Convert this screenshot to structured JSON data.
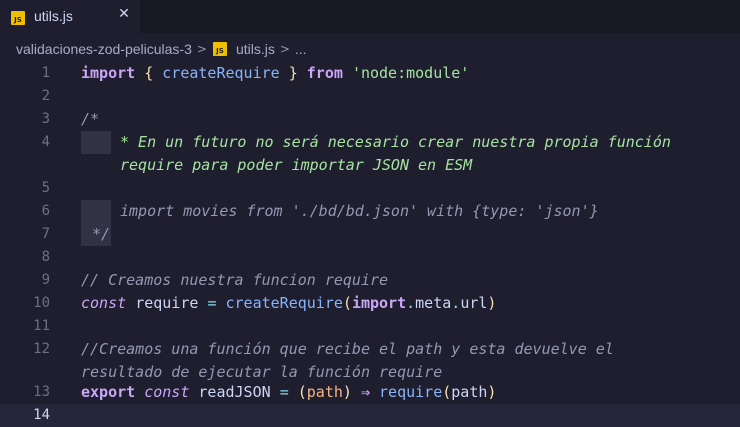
{
  "tab": {
    "icon_text": "JS",
    "label": "utils.js",
    "close_glyph": "✕"
  },
  "breadcrumb": {
    "folder": "validaciones-zod-peliculas-3",
    "file": "utils.js",
    "more": "..."
  },
  "editor": {
    "active_line": 14,
    "line_numbers": [
      "1",
      "2",
      "3",
      "4",
      "5",
      "6",
      "7",
      "8",
      "9",
      "10",
      "11",
      "12",
      "13",
      "14"
    ]
  },
  "code": {
    "l1_import": "import",
    "l1_name": "createRequire",
    "l1_from": "from",
    "l1_module": "'node:module'",
    "l3": "/*",
    "l4a": "* En un futuro no será necesario crear nuestra propia función",
    "l4b": "require para poder importar JSON en ESM",
    "l6": "import movies from './bd/bd.json' with {type: 'json'}",
    "l7": "*/",
    "l9": "// Creamos nuestra funcion require",
    "l10_const": "const",
    "l10_var": "require",
    "l10_fn": "createRequire",
    "l10_import": "import",
    "l10_meta": "meta",
    "l10_url": "url",
    "l12a": "//Creamos una función que recibe el path y esta devuelve el",
    "l12b": "resultado de ejecutar la función require",
    "l13_export": "export",
    "l13_const": "const",
    "l13_name": "readJSON",
    "l13_param": "path",
    "l13_arrow": "⇒",
    "l13_fn": "require",
    "l13_arg": "path"
  },
  "colors": {
    "background": "#1e1e2e",
    "keyword": "#cba6f7",
    "function": "#89b4fa",
    "string": "#a6e3a1",
    "comment": "#9399b2",
    "parameter": "#fab387",
    "js_icon": "#f0c000"
  }
}
